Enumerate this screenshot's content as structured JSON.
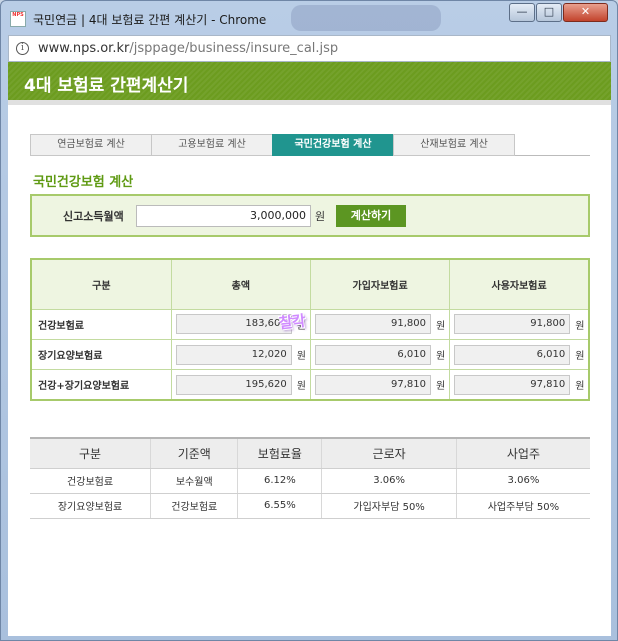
{
  "window": {
    "title": "국민연금 | 4대 보험료 간편 계산기 - Chrome",
    "app_icon_text": "NPS"
  },
  "address_bar": {
    "domain": "www.nps.or.kr",
    "path": "/jsppage/business/insure_cal.jsp"
  },
  "header": {
    "title": "4대 보험료 간편계산기"
  },
  "tabs": [
    {
      "label": "연금보험료 계산"
    },
    {
      "label": "고용보험료 계산"
    },
    {
      "label": "국민건강보험 계산",
      "active": true
    },
    {
      "label": "산재보험료 계산"
    }
  ],
  "section": {
    "title": "국민건강보험 계산"
  },
  "input": {
    "label": "신고소득월액",
    "value": "3,000,000",
    "unit": "원",
    "calc_button": "계산하기"
  },
  "results": {
    "headers": [
      "구분",
      "총액",
      "가입자보험료",
      "사용자보험료"
    ],
    "unit": "원",
    "rows": [
      {
        "label": "건강보험료",
        "total": "183,600",
        "employee": "91,800",
        "employer": "91,800"
      },
      {
        "label": "장기요양보험료",
        "total": "12,020",
        "employee": "6,010",
        "employer": "6,010"
      },
      {
        "label": "건강+장기요양보험료",
        "total": "195,620",
        "employee": "97,810",
        "employer": "97,810"
      }
    ]
  },
  "rates_table": {
    "headers": [
      "구분",
      "기준액",
      "보험료율",
      "근로자",
      "사업주"
    ],
    "rows": [
      [
        "건강보험료",
        "보수월액",
        "6.12%",
        "3.06%",
        "3.06%"
      ],
      [
        "장기요양보험료",
        "건강보험료",
        "6.55%",
        "가입자부담 50%",
        "사업주부담 50%"
      ]
    ]
  },
  "watermark_text": "찰칵"
}
